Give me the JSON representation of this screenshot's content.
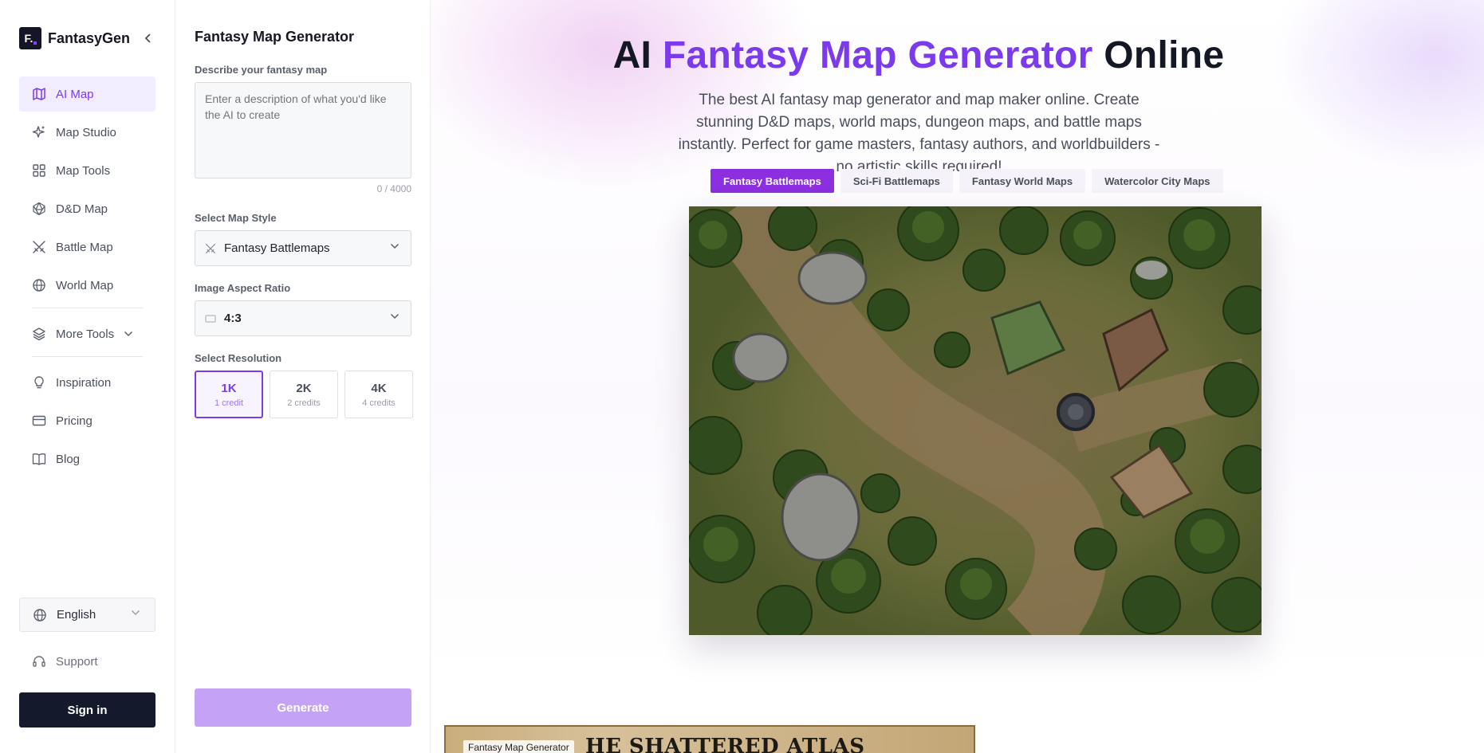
{
  "app": {
    "name": "FantasyGen",
    "logo_letter": "F."
  },
  "sidebar": {
    "items": [
      {
        "label": "AI Map",
        "icon": "map-icon",
        "active": true
      },
      {
        "label": "Map Studio",
        "icon": "sparkles-icon"
      },
      {
        "label": "Map Tools",
        "icon": "grid-icon"
      },
      {
        "label": "D&D Map",
        "icon": "d20-icon"
      },
      {
        "label": "Battle Map",
        "icon": "crossed-swords-icon"
      },
      {
        "label": "World Map",
        "icon": "globe-icon"
      }
    ],
    "more_tools": "More Tools",
    "secondary": [
      {
        "label": "Inspiration",
        "icon": "lightbulb-icon"
      },
      {
        "label": "Pricing",
        "icon": "credit-card-icon"
      },
      {
        "label": "Blog",
        "icon": "book-icon"
      }
    ],
    "language": "English",
    "support": "Support",
    "sign_in": "Sign in"
  },
  "form": {
    "title": "Fantasy Map Generator",
    "describe_label": "Describe your fantasy map",
    "describe_placeholder": "Enter a description of what you'd like the AI to create",
    "counter": "0 / 4000",
    "style_label": "Select Map Style",
    "style_value": "Fantasy Battlemaps",
    "ratio_label": "Image Aspect Ratio",
    "ratio_value": "4:3",
    "resolution_label": "Select Resolution",
    "resolutions": [
      {
        "label": "1K",
        "credits": "1 credit",
        "selected": true
      },
      {
        "label": "2K",
        "credits": "2 credits"
      },
      {
        "label": "4K",
        "credits": "4 credits"
      }
    ],
    "generate": "Generate"
  },
  "hero": {
    "title_prefix": "AI",
    "title_accent": "Fantasy Map Generator",
    "title_suffix": "Online",
    "subtitle": "The best AI fantasy map generator and map maker online. Create stunning D&D maps, world maps, dungeon maps, and battle maps instantly. Perfect for game masters, fantasy authors, and worldbuilders - no artistic skills required!",
    "tabs": [
      "Fantasy Battlemaps",
      "Sci-Fi Battlemaps",
      "Fantasy World Maps",
      "Watercolor City Maps"
    ],
    "active_tab": 0
  },
  "preview": {
    "badge": "Fantasy Map Generator",
    "atlas_title": "HE SHATTERED ATLAS"
  },
  "colors": {
    "accent": "#7c3aed",
    "active_tab": "#8b2fe0",
    "signin_bg": "#141a2b",
    "generate_bg": "#c4a3f7"
  }
}
